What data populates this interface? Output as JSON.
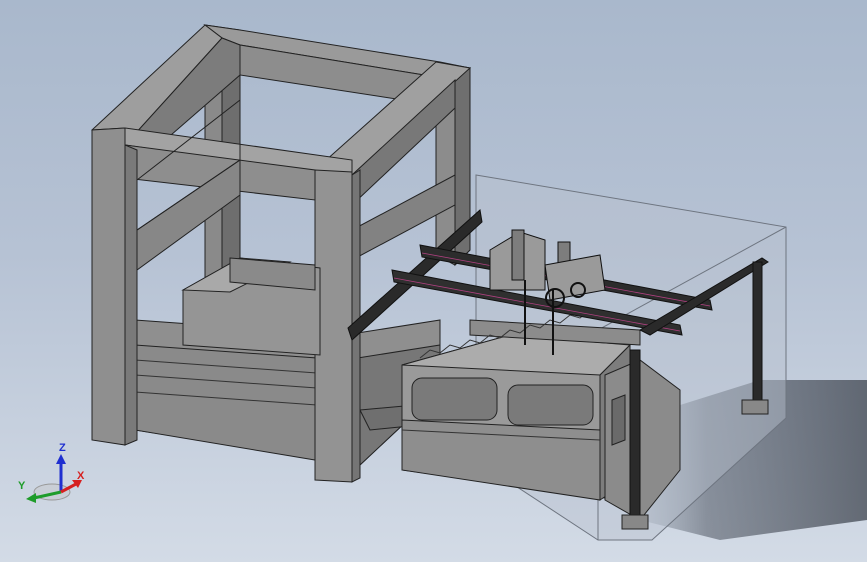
{
  "viewport": {
    "background_top": "#a9b8cc",
    "background_bottom": "#d3dbe6"
  },
  "triad": {
    "x_label": "X",
    "y_label": "Y",
    "z_label": "Z",
    "x_color": "#d62020",
    "y_color": "#1e9c2a",
    "z_color": "#1f2fd0"
  }
}
